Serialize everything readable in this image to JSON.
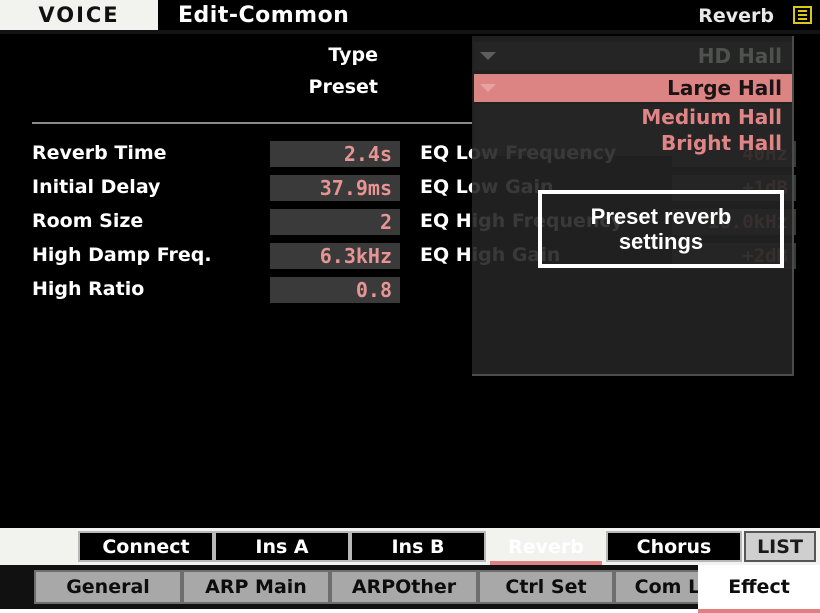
{
  "titlebar": {
    "mode": "VOICE",
    "screen": "Edit-Common",
    "section": "Reverb",
    "list_icon": "list-icon"
  },
  "effect_header": {
    "type_label": "Type",
    "type_value": "HD Hall",
    "preset_label": "Preset",
    "preset_value": "Large Hall",
    "dropdown_items": [
      "Medium Hall",
      "Bright Hall"
    ]
  },
  "params_left": [
    {
      "label": "Reverb Time",
      "value": "2.4s"
    },
    {
      "label": "Initial Delay",
      "value": "37.9ms"
    },
    {
      "label": "Room Size",
      "value": "2"
    },
    {
      "label": "High Damp Freq.",
      "value": "6.3kHz"
    },
    {
      "label": "High Ratio",
      "value": "0.8"
    }
  ],
  "params_right": [
    {
      "label": "EQ Low Frequency",
      "value": "40Hz"
    },
    {
      "label": "EQ Low Gain",
      "value": "+1dB"
    },
    {
      "label": "EQ High Frequency",
      "value": "16.0kHz"
    },
    {
      "label": "EQ High Gain",
      "value": "+2dB"
    }
  ],
  "callout": {
    "line1": "Preset reverb",
    "line2": "settings"
  },
  "function_tabs": [
    {
      "label": "Connect",
      "active": false,
      "boxed": false
    },
    {
      "label": "Ins A",
      "active": false,
      "boxed": false
    },
    {
      "label": "Ins B",
      "active": false,
      "boxed": false
    },
    {
      "label": "Reverb",
      "active": true,
      "boxed": false
    },
    {
      "label": "Chorus",
      "active": false,
      "boxed": false
    },
    {
      "label": "LIST",
      "active": false,
      "boxed": true
    }
  ],
  "page_tabs": [
    {
      "label": "General",
      "active": false
    },
    {
      "label": "ARP Main",
      "active": false
    },
    {
      "label": "ARPOther",
      "active": false
    },
    {
      "label": "Ctrl Set",
      "active": false
    },
    {
      "label": "Com LFO",
      "active": false
    },
    {
      "label": "Effect",
      "active": true
    }
  ],
  "colors": {
    "accent_pink": "#e08080",
    "value_text": "#e79494",
    "highlight_row": "#dc8383",
    "field_bg": "#3a3a3a",
    "lcd_bg": "#000000",
    "list_icon": "#d9c916"
  }
}
